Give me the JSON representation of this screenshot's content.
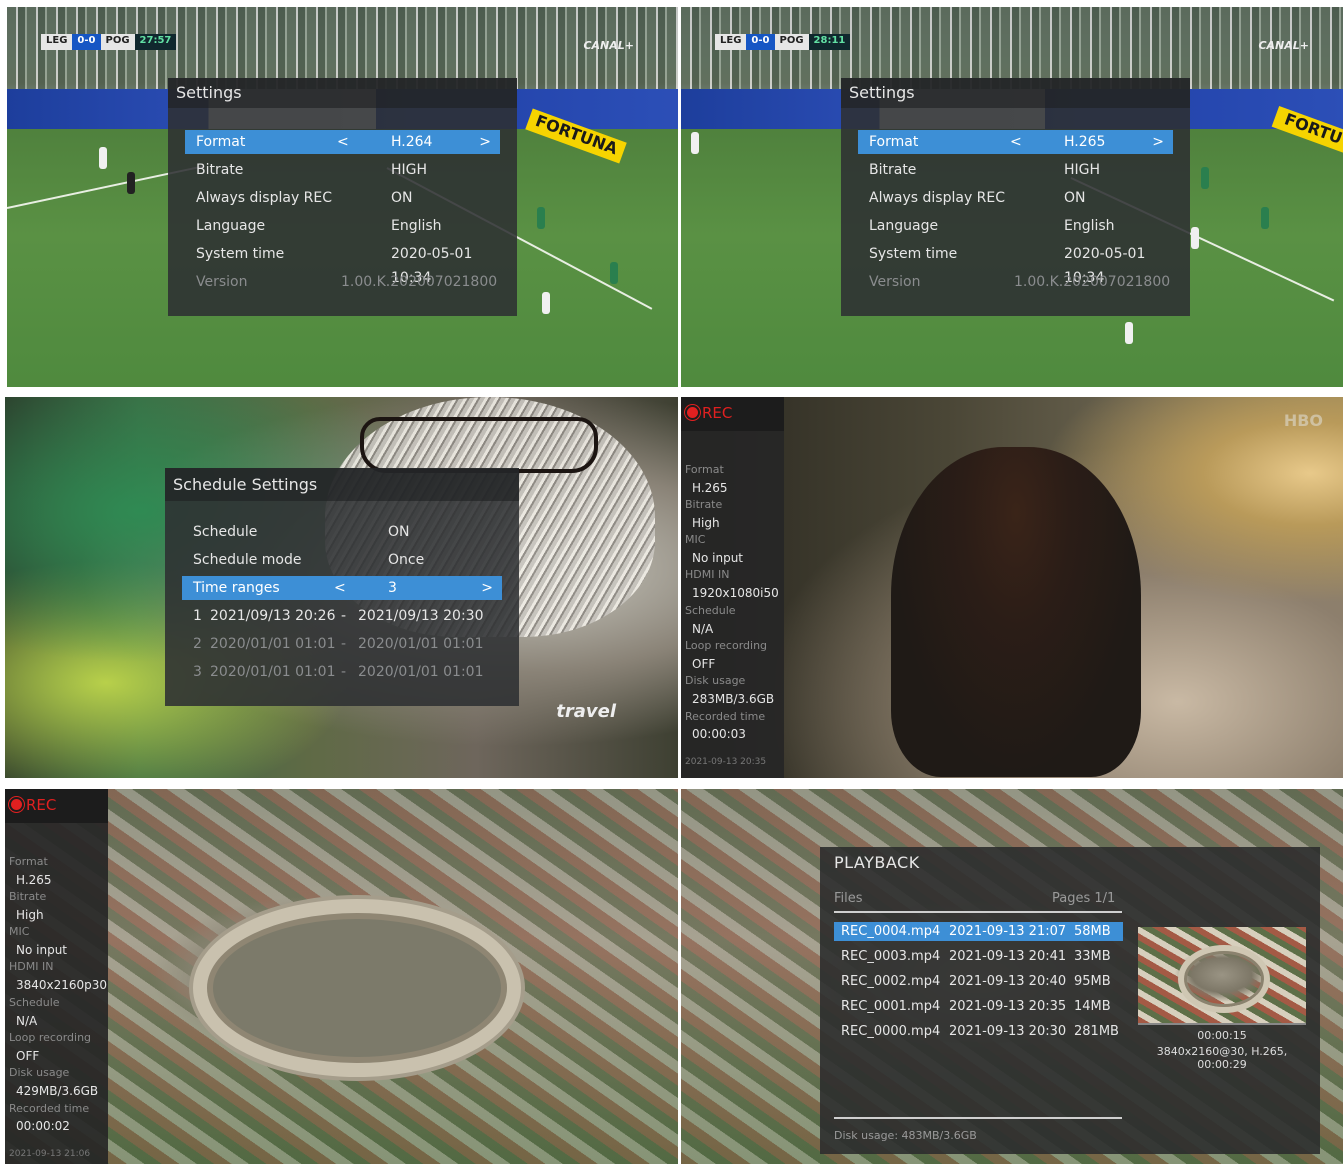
{
  "panel1": {
    "scoreboard": {
      "home": "LEG",
      "score": "0-0",
      "away": "POG",
      "time": "27:57"
    },
    "broadcaster": "CANAL+",
    "ad": "FORTUNA",
    "settings": {
      "title": "Settings",
      "rows": [
        {
          "label": "Format",
          "value": "H.264",
          "left": "<",
          "right": ">"
        },
        {
          "label": "Bitrate",
          "value": "HIGH"
        },
        {
          "label": "Always display REC",
          "value": "ON"
        },
        {
          "label": "Language",
          "value": "English"
        },
        {
          "label": "System time",
          "value": "2020-05-01 10:34"
        },
        {
          "label": "Version",
          "value": "1.00.K.202007021800"
        }
      ]
    }
  },
  "panel2": {
    "scoreboard": {
      "home": "LEG",
      "score": "0-0",
      "away": "POG",
      "time": "28:11"
    },
    "broadcaster": "CANAL+",
    "ad": "FORTU",
    "settings": {
      "title": "Settings",
      "rows": [
        {
          "label": "Format",
          "value": "H.265",
          "left": "<",
          "right": ">"
        },
        {
          "label": "Bitrate",
          "value": "HIGH"
        },
        {
          "label": "Always display REC",
          "value": "ON"
        },
        {
          "label": "Language",
          "value": "English"
        },
        {
          "label": "System time",
          "value": "2020-05-01 10:34"
        },
        {
          "label": "Version",
          "value": "1.00.K.202007021800"
        }
      ]
    }
  },
  "panel3": {
    "watermark": "travel",
    "schedule": {
      "title": "Schedule Settings",
      "rows": [
        {
          "label": "Schedule",
          "value": "ON"
        },
        {
          "label": "Schedule mode",
          "value": "Once"
        },
        {
          "label": "Time ranges",
          "value": "3",
          "left": "<",
          "right": ">"
        }
      ],
      "ranges": [
        {
          "idx": "1",
          "start": "2021/09/13 20:26",
          "sep": "-",
          "end": "2021/09/13 20:30"
        },
        {
          "idx": "2",
          "start": "2020/01/01 01:01",
          "sep": "-",
          "end": "2020/01/01 01:01"
        },
        {
          "idx": "3",
          "start": "2020/01/01 01:01",
          "sep": "-",
          "end": "2020/01/01 01:01"
        }
      ]
    }
  },
  "panel4": {
    "rec": "REC",
    "watermark": "HBO",
    "stats": [
      {
        "key": "Format",
        "value": "H.265"
      },
      {
        "key": "Bitrate",
        "value": "High"
      },
      {
        "key": "MIC",
        "value": "No input"
      },
      {
        "key": "HDMI IN",
        "value": "1920x1080i50"
      },
      {
        "key": "Schedule",
        "value": "N/A"
      },
      {
        "key": "Loop recording",
        "value": "OFF"
      },
      {
        "key": "Disk usage",
        "value": "283MB/3.6GB"
      },
      {
        "key": "Recorded time",
        "value": "00:00:03"
      }
    ],
    "timestamp": "2021-09-13 20:35"
  },
  "panel5": {
    "rec": "REC",
    "stats": [
      {
        "key": "Format",
        "value": "H.265"
      },
      {
        "key": "Bitrate",
        "value": "High"
      },
      {
        "key": "MIC",
        "value": "No input"
      },
      {
        "key": "HDMI IN",
        "value": "3840x2160p30"
      },
      {
        "key": "Schedule",
        "value": "N/A"
      },
      {
        "key": "Loop recording",
        "value": "OFF"
      },
      {
        "key": "Disk usage",
        "value": "429MB/3.6GB"
      },
      {
        "key": "Recorded time",
        "value": "00:00:02"
      }
    ],
    "timestamp": "2021-09-13 21:06"
  },
  "panel6": {
    "playback": {
      "title": "PLAYBACK",
      "files_label": "Files",
      "pages": "Pages 1/1",
      "files": [
        {
          "name": "REC_0004.mp4",
          "date": "2021-09-13 21:07",
          "size": "58MB"
        },
        {
          "name": "REC_0003.mp4",
          "date": "2021-09-13 20:41",
          "size": "33MB"
        },
        {
          "name": "REC_0002.mp4",
          "date": "2021-09-13 20:40",
          "size": "95MB"
        },
        {
          "name": "REC_0001.mp4",
          "date": "2021-09-13 20:35",
          "size": "14MB"
        },
        {
          "name": "REC_0000.mp4",
          "date": "2021-09-13 20:30",
          "size": "281MB"
        }
      ],
      "preview_time": "00:00:15",
      "preview_info": "3840x2160@30, H.265, 00:00:29",
      "disk_usage": "Disk usage: 483MB/3.6GB"
    }
  },
  "colors": {
    "highlight": "#3d8fd6",
    "rec_red": "#e02020",
    "dialog_bg": "#2e3032"
  }
}
